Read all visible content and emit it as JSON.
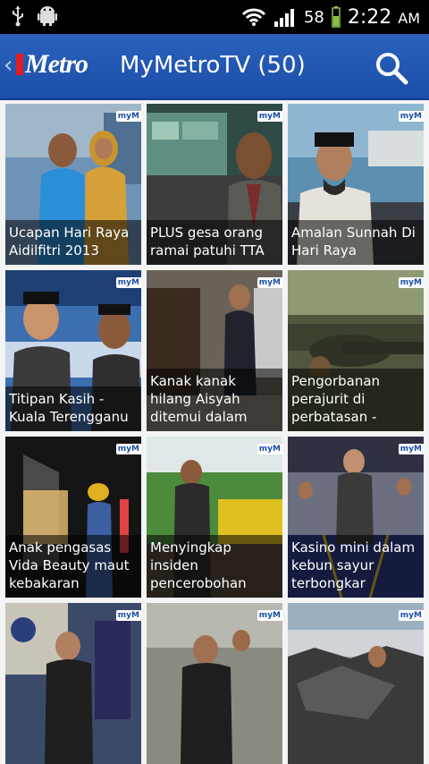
{
  "status": {
    "battery": "58",
    "time": "2:22",
    "ampm": "AM"
  },
  "appbar": {
    "logo": "Metro",
    "title": "MyMetroTV (50)"
  },
  "videos": [
    {
      "caption": "Ucapan Hari Raya Aidilfitri 2013",
      "badge": "myM"
    },
    {
      "caption": "PLUS gesa orang ramai patuhi TTA",
      "badge": "myM"
    },
    {
      "caption": "Amalan Sunnah Di Hari Raya",
      "badge": "myM"
    },
    {
      "caption": "Titipan Kasih - Kuala Terengganu",
      "badge": "myM"
    },
    {
      "caption": "Kanak kanak hilang Aisyah ditemui dalam",
      "badge": "myM"
    },
    {
      "caption": "Pengorbanan perajurit di perbatasan -",
      "badge": "myM"
    },
    {
      "caption": "Anak pengasas Vida Beauty maut kebakaran",
      "badge": "myM"
    },
    {
      "caption": "Menyingkap insiden pencerobohan",
      "badge": "myM"
    },
    {
      "caption": "Kasino mini dalam kebun sayur terbongkar",
      "badge": "myM"
    },
    {
      "caption": "",
      "badge": "myM"
    },
    {
      "caption": "",
      "badge": "myM"
    },
    {
      "caption": "",
      "badge": "myM"
    }
  ]
}
